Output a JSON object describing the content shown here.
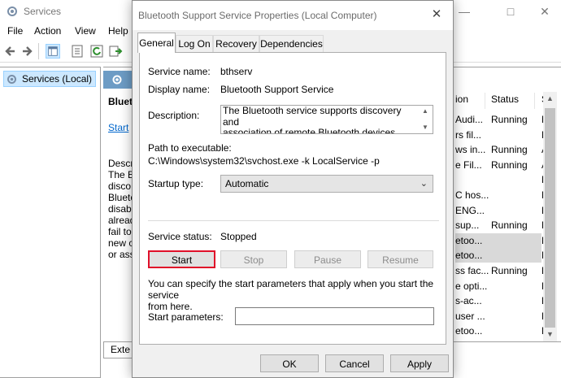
{
  "services_window": {
    "title": "Services",
    "menu": [
      "File",
      "Action",
      "View",
      "Help"
    ],
    "tree_item": "Services (Local)",
    "detail": {
      "name_partial": "Blueto",
      "start_link": "Start",
      "desc_lines": [
        "Descr",
        "The B",
        "disco",
        "Blueto",
        "disab",
        "alread",
        "fail to",
        "new c",
        "or ass"
      ],
      "bottom_tab": "Exte"
    },
    "list": {
      "col_name_partial": "ion",
      "col_status": "Status",
      "col_startup_partial": "S",
      "rows": [
        {
          "desc": "Audi...",
          "status": "Running",
          "startup": "M"
        },
        {
          "desc": "rs fil...",
          "status": "",
          "startup": "M"
        },
        {
          "desc": "ws in...",
          "status": "Running",
          "startup": "A"
        },
        {
          "desc": "e Fil...",
          "status": "Running",
          "startup": "A"
        },
        {
          "desc": "",
          "status": "",
          "startup": "M"
        },
        {
          "desc": "C hos...",
          "status": "",
          "startup": "M"
        },
        {
          "desc": "ENG...",
          "status": "",
          "startup": "M"
        },
        {
          "desc": "sup...",
          "status": "Running",
          "startup": "M"
        },
        {
          "desc": "etoo...",
          "status": "",
          "startup": "M"
        },
        {
          "desc": "etoo...",
          "status": "",
          "startup": "M"
        },
        {
          "desc": "ss fac...",
          "status": "Running",
          "startup": "M"
        },
        {
          "desc": "e opti...",
          "status": "",
          "startup": "M"
        },
        {
          "desc": "s-ac...",
          "status": "",
          "startup": "M"
        },
        {
          "desc": "user ...",
          "status": "",
          "startup": "M"
        },
        {
          "desc": "etoo...",
          "status": "",
          "startup": "M"
        }
      ]
    }
  },
  "dialog": {
    "title": "Bluetooth Support Service Properties (Local Computer)",
    "tabs": [
      "General",
      "Log On",
      "Recovery",
      "Dependencies"
    ],
    "service_name_label": "Service name:",
    "service_name": "bthserv",
    "display_name_label": "Display name:",
    "display_name": "Bluetooth Support Service",
    "description_label": "Description:",
    "description": "The Bluetooth service supports discovery and\nassociation of remote Bluetooth devices.  Stopping\nor disabling this service may cause already installed",
    "path_label": "Path to executable:",
    "path": "C:\\Windows\\system32\\svchost.exe -k LocalService -p",
    "startup_type_label": "Startup type:",
    "startup_type": "Automatic",
    "status_label": "Service status:",
    "status": "Stopped",
    "buttons": {
      "start": "Start",
      "stop": "Stop",
      "pause": "Pause",
      "resume": "Resume"
    },
    "hint": "You can specify the start parameters that apply when you start the service\nfrom here.",
    "start_params_label": "Start parameters:",
    "start_params_value": "",
    "footer": {
      "ok": "OK",
      "cancel": "Cancel",
      "apply": "Apply"
    }
  },
  "colors": {
    "focus_outline": "#e0102a",
    "detail_header": "#6d9cc5",
    "selection": "#cce8ff"
  }
}
